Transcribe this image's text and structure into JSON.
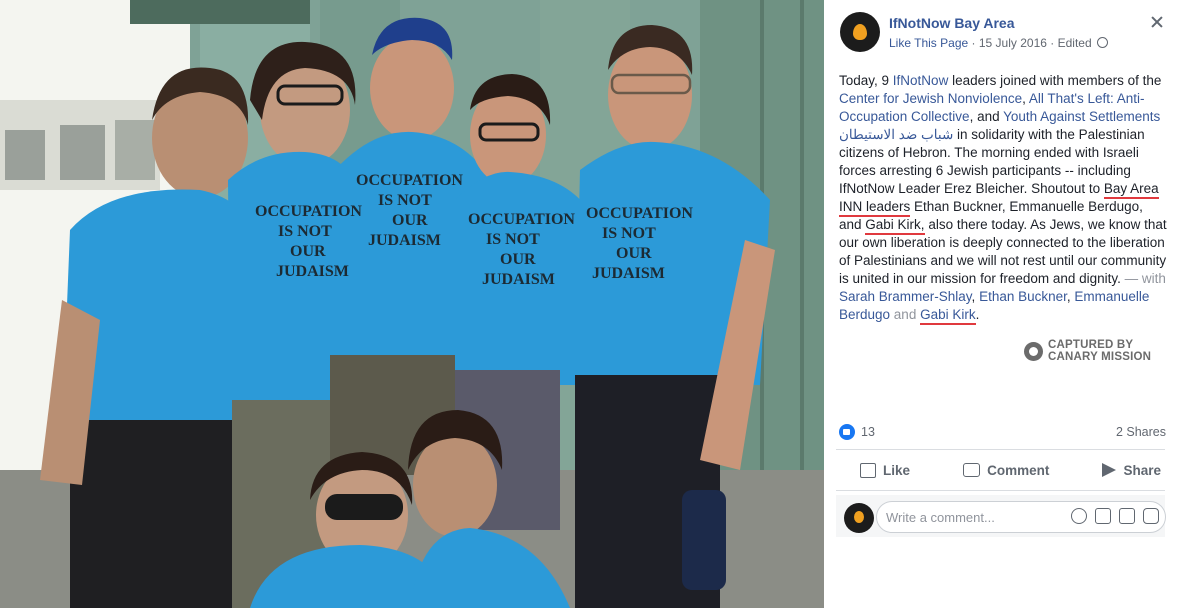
{
  "post": {
    "page_name": "IfNotNow Bay Area",
    "like_page": "Like This Page",
    "separator": "·",
    "date": "15 July 2016",
    "edited": "Edited",
    "text": {
      "p1": "Today, 9 ",
      "link_ifnotnow": "IfNotNow",
      "p2": " leaders joined with members of the ",
      "link_cjn": "Center for Jewish Nonviolence",
      "p3": ", ",
      "link_atl": "All That's Left: Anti-Occupation Collective",
      "p4": ", and ",
      "link_yas": "Youth Against Settlements شباب ضد الاستيطان",
      "p5": " in solidarity with the Palestinian citizens of Hebron. The morning ended with Israeli forces arresting 6 Jewish participants -- including IfNotNow Leader Erez Bleicher. Shoutout to ",
      "highlight_1": "Bay Area INN leaders",
      "p6": " Ethan Buckner, Emmanuelle Berdugo, and ",
      "highlight_2": "Gabi Kirk,",
      "p7": " also there today. As Jews, we know that our own liberation is deeply connected to the liberation of Palestinians and we will not rest until our community is united in our mission for freedom and dignity.",
      "with_prefix": " — with ",
      "tag_sarah": "Sarah Brammer-Shlay",
      "comma_1": ", ",
      "tag_ethan": "Ethan Buckner",
      "comma_2": ", ",
      "tag_emmanuelle": "Emmanuelle Berdugo",
      "and": " and ",
      "tag_gabi": "Gabi Kirk",
      "end": "."
    },
    "watermark_line1": "CAPTURED BY",
    "watermark_line2": "CANARY MISSION"
  },
  "stats": {
    "likes": "13",
    "shares": "2 Shares"
  },
  "actions": {
    "like": "Like",
    "comment": "Comment",
    "share": "Share"
  },
  "comment_box": {
    "placeholder": "Write a comment..."
  },
  "photo": {
    "shirt_text": [
      "OCCUPATION",
      "IS NOT",
      "OUR",
      "JUDAISM"
    ],
    "shirt_color": "#2c9ad8"
  },
  "colors": {
    "link": "#385898",
    "highlight_underline": "#e0393e",
    "like_blue": "#1877f2",
    "avatar_bg": "#1c1c1c",
    "avatar_flame": "#f0a020"
  }
}
